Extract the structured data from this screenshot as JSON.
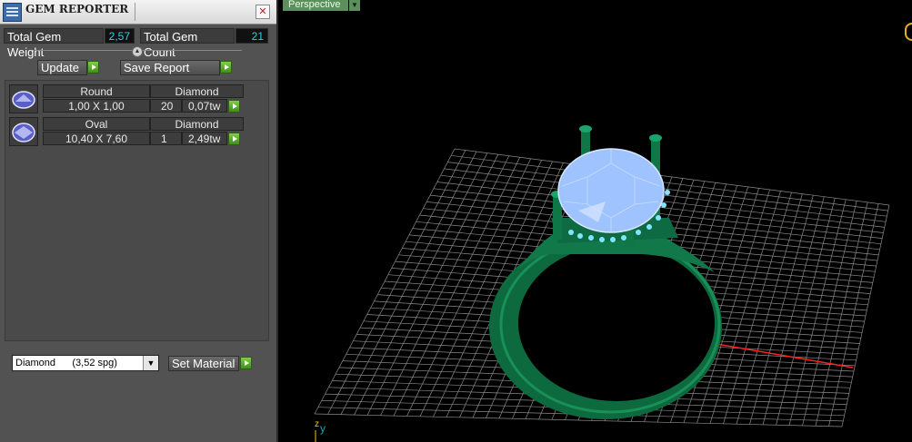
{
  "panel": {
    "title": "GEM REPORTER",
    "close_glyph": "✕",
    "total_weight_label": "Total Gem Weight",
    "total_weight_value": "2,57",
    "total_count_label": "Total Gem Count",
    "total_count_value": "21",
    "update_label": "Update",
    "save_report_label": "Save Report",
    "gems": [
      {
        "shape": "Round",
        "type": "Diamond",
        "size": "1,00 X 1,00",
        "count": "20",
        "weight": "0,07tw"
      },
      {
        "shape": "Oval",
        "type": "Diamond",
        "size": "10,40 X 7,60",
        "count": "1",
        "weight": "2,49tw"
      }
    ],
    "material_value": "Diamond      (3,52 spg)",
    "set_material_label": "Set Material"
  },
  "viewport": {
    "view_name": "Perspective",
    "axis_y": "y",
    "axis_z": "z"
  },
  "colors": {
    "panel_bg": "#525252",
    "value_text": "#22d7e6",
    "ring_green": "#0d6a3e",
    "gem_blue": "#9fc3ff",
    "axis_red": "#ff2020",
    "axis_cyan": "#11a9b5"
  },
  "icons": [
    "app-icon",
    "close-icon",
    "splitter-icon",
    "play-icon",
    "gem-thumbnail-icon",
    "dropdown-arrow-icon",
    "orbit-icon"
  ]
}
